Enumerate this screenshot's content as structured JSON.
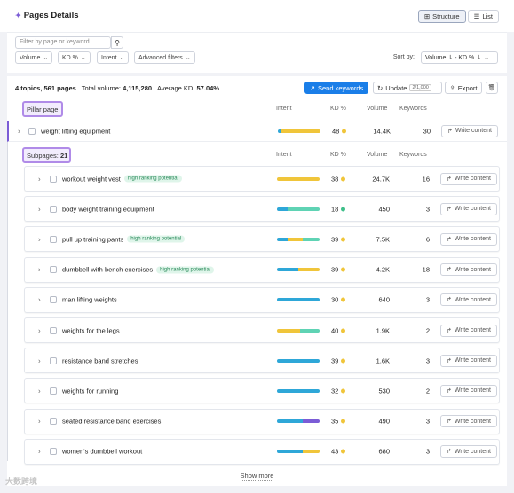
{
  "header": {
    "title": "Pages Details",
    "views": [
      "Structure",
      "List"
    ]
  },
  "filters": {
    "search_placeholder": "Filter by page or keyword",
    "dropdowns": [
      "Volume",
      "KD %",
      "Intent",
      "Advanced filters"
    ],
    "sort_label": "Sort by:",
    "sort_value": "Volume ⇂ - KD % ⇂"
  },
  "toolbar": {
    "topics": "4 topics, 561 pages",
    "total_volume_label": "Total volume:",
    "total_volume": "4,115,280",
    "avg_kd_label": "Average KD:",
    "avg_kd": "57.04%",
    "send": "Send keywords",
    "update": "Update",
    "update_count": "2/1,000",
    "export": "Export"
  },
  "columns": {
    "intent": "Intent",
    "kd": "KD %",
    "volume": "Volume",
    "keywords": "Keywords"
  },
  "pillar": {
    "label": "Pillar page",
    "keyword": "weight lifting equipment",
    "kd": "48",
    "volume": "14.4K",
    "keywords": "30",
    "intent": [
      {
        "c": "#2ea7d8",
        "f": 0.08
      },
      {
        "c": "#f0c53a",
        "f": 0.92
      }
    ],
    "dot": "#f0c53a",
    "action": "Write content"
  },
  "subpages": {
    "label": "Subpages:",
    "count": "21",
    "rows": [
      {
        "keyword": "workout weight vest",
        "badge": "high ranking potential",
        "kd": "38",
        "volume": "24.7K",
        "keywords": "16",
        "dot": "#f0c53a",
        "intent": [
          {
            "c": "#f0c53a",
            "f": 1.0
          }
        ]
      },
      {
        "keyword": "body weight training equipment",
        "badge": "",
        "kd": "18",
        "volume": "450",
        "keywords": "3",
        "dot": "#3fbf8a",
        "intent": [
          {
            "c": "#2ea7d8",
            "f": 0.25
          },
          {
            "c": "#5fd3b4",
            "f": 0.75
          }
        ]
      },
      {
        "keyword": "pull up training pants",
        "badge": "high ranking potential",
        "kd": "39",
        "volume": "7.5K",
        "keywords": "6",
        "dot": "#f0c53a",
        "intent": [
          {
            "c": "#2ea7d8",
            "f": 0.25
          },
          {
            "c": "#f0c53a",
            "f": 0.35
          },
          {
            "c": "#5fd3b4",
            "f": 0.4
          }
        ]
      },
      {
        "keyword": "dumbbell with bench exercises",
        "badge": "high ranking potential",
        "kd": "39",
        "volume": "4.2K",
        "keywords": "18",
        "dot": "#f0c53a",
        "intent": [
          {
            "c": "#2ea7d8",
            "f": 0.5
          },
          {
            "c": "#f0c53a",
            "f": 0.5
          }
        ]
      },
      {
        "keyword": "man lifting weights",
        "badge": "",
        "kd": "30",
        "volume": "640",
        "keywords": "3",
        "dot": "#f0c53a",
        "intent": [
          {
            "c": "#2ea7d8",
            "f": 1.0
          }
        ]
      },
      {
        "keyword": "weights for the legs",
        "badge": "",
        "kd": "40",
        "volume": "1.9K",
        "keywords": "2",
        "dot": "#f0c53a",
        "intent": [
          {
            "c": "#f0c53a",
            "f": 0.55
          },
          {
            "c": "#5fd3b4",
            "f": 0.45
          }
        ]
      },
      {
        "keyword": "resistance band stretches",
        "badge": "",
        "kd": "39",
        "volume": "1.6K",
        "keywords": "3",
        "dot": "#f0c53a",
        "intent": [
          {
            "c": "#2ea7d8",
            "f": 1.0
          }
        ]
      },
      {
        "keyword": "weights for running",
        "badge": "",
        "kd": "32",
        "volume": "530",
        "keywords": "2",
        "dot": "#f0c53a",
        "intent": [
          {
            "c": "#2ea7d8",
            "f": 1.0
          }
        ]
      },
      {
        "keyword": "seated resistance band exercises",
        "badge": "",
        "kd": "35",
        "volume": "490",
        "keywords": "3",
        "dot": "#f0c53a",
        "intent": [
          {
            "c": "#2ea7d8",
            "f": 0.6
          },
          {
            "c": "#7b5cd6",
            "f": 0.4
          }
        ]
      },
      {
        "keyword": "women's dumbbell workout",
        "badge": "",
        "kd": "43",
        "volume": "680",
        "keywords": "3",
        "dot": "#f0c53a",
        "intent": [
          {
            "c": "#2ea7d8",
            "f": 0.6
          },
          {
            "c": "#f0c53a",
            "f": 0.4
          }
        ]
      }
    ],
    "action": "Write content"
  },
  "show_more": "Show more",
  "watermark": "大数跨境"
}
